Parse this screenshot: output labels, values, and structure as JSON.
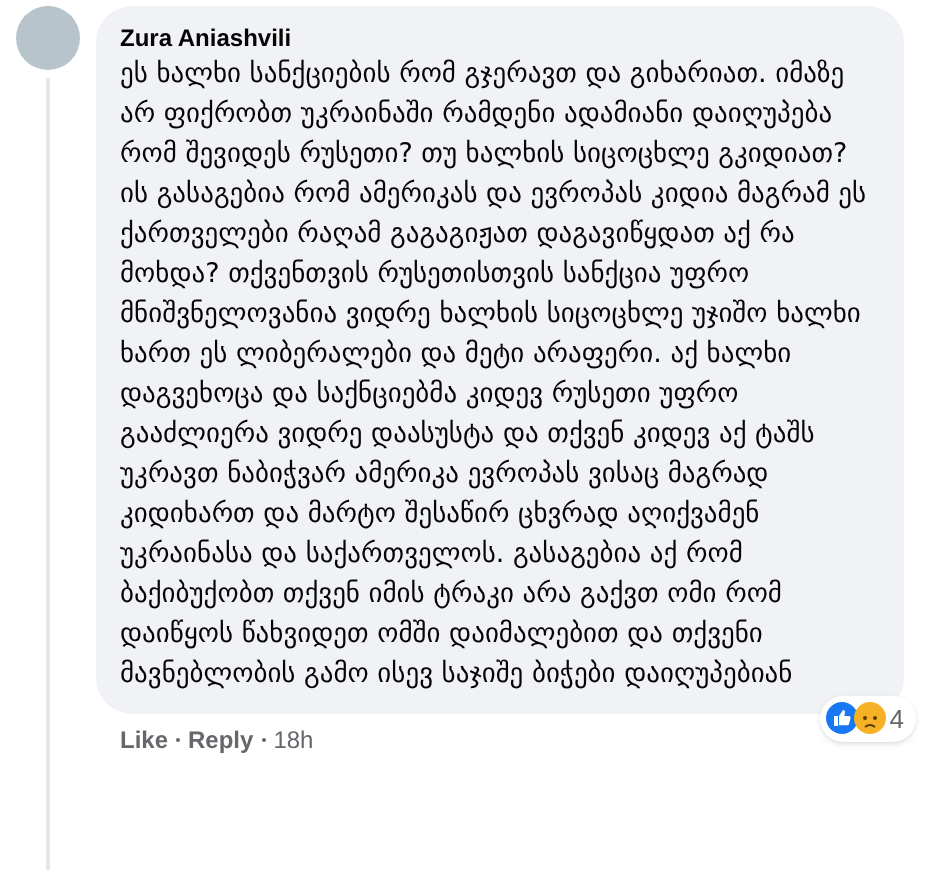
{
  "comment": {
    "author": "Zura Aniashvili",
    "text": "ეს ხალხი სანქციების რომ გჯერავთ და გიხარიათ. იმაზე არ ფიქრობთ უკრაინაში რამდენი ადამიანი დაიღუპება რომ შევიდეს რუსეთი? თუ ხალხის სიცოცხლე გკიდიათ? ის გასაგებია რომ ამერიკას და ევროპას კიდია მაგრამ ეს ქართველები რაღამ გაგაგიჟათ დაგავიწყდათ აქ რა მოხდა? თქვენთვის რუსეთისთვის სანქცია უფრო მნიშვნელოვანია ვიდრე ხალხის სიცოცხლე უჯიშო ხალხი ხართ ეს ლიბერალები და მეტი არაფერი. აქ ხალხი დაგვეხოცა და საქნციებმა კიდევ რუსეთი უფრო გააძლიერა ვიდრე დაასუსტა და თქვენ კიდევ აქ ტაშს უკრავთ ნაბიჭვარ ამერიკა ევროპას ვისაც მაგრად კიდიხართ და მარტო შესაწირ ცხვრად აღიქვამენ უკრაინასა და საქართველოს. გასაგებია აქ რომ ბაქიბუქობთ თქვენ იმის ტრაკი არა გაქვთ ომი რომ დაიწყოს წახვიდეთ ომში დაიმალებით და თქვენი მავნებლობის გამო ისევ საჯიშე ბიჭები დაიღუპებიან",
    "reaction_count": "4",
    "actions": [
      "Like",
      "Reply"
    ],
    "time": "18h"
  }
}
